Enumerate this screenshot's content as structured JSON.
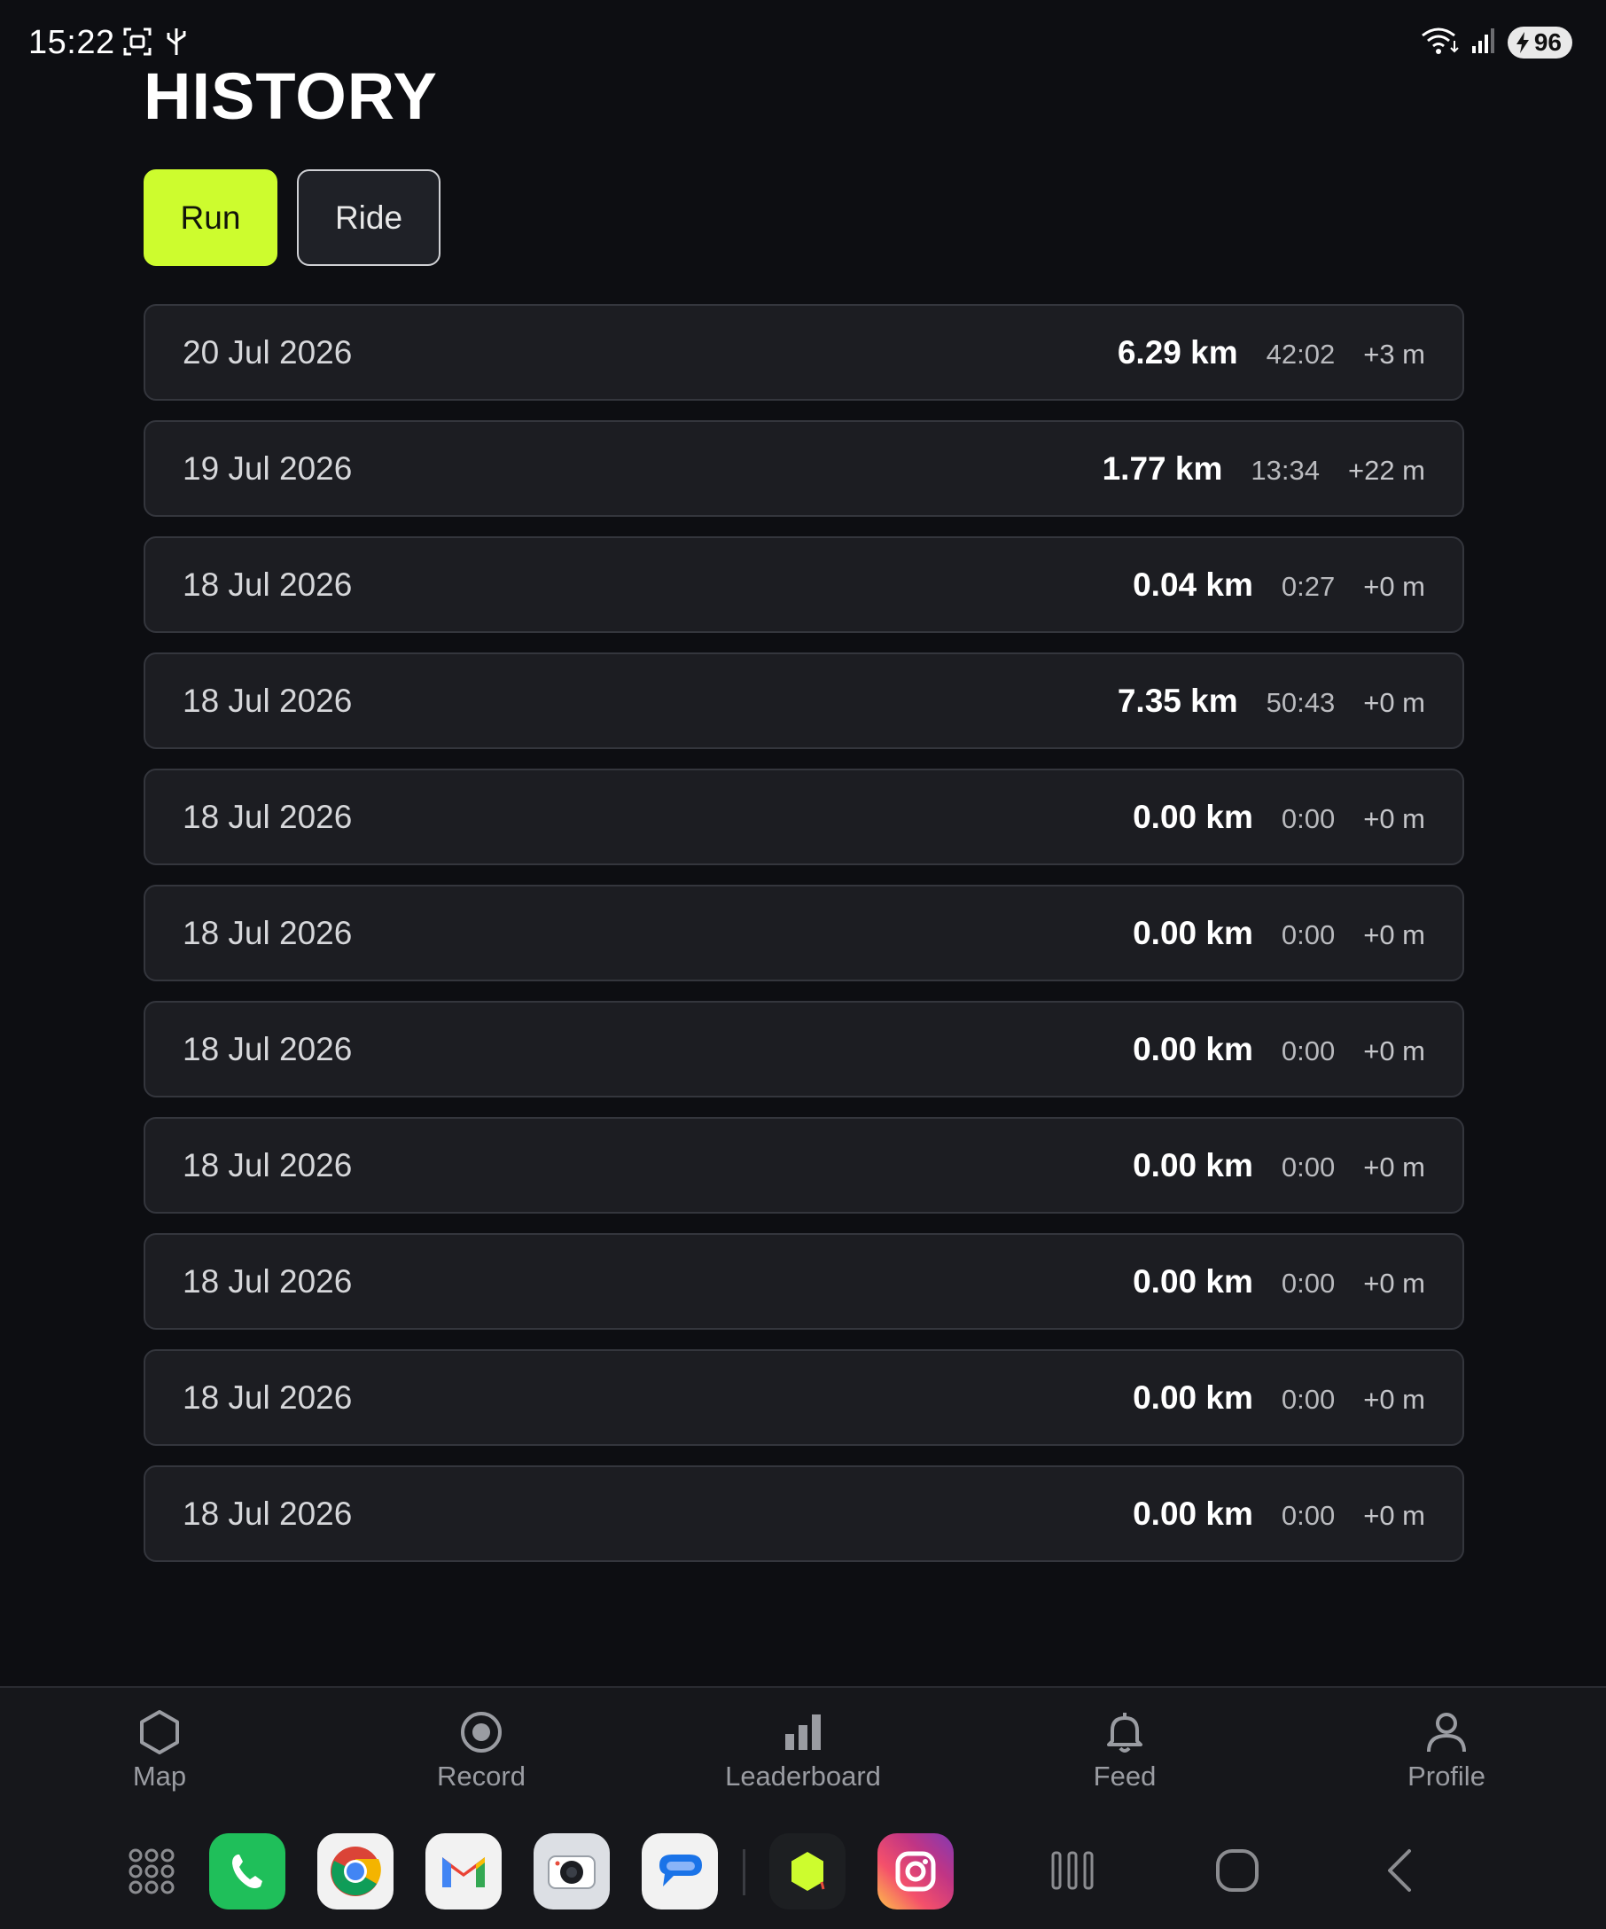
{
  "status_bar": {
    "time": "15:22",
    "battery": "96",
    "icons": [
      "screenshot-icon",
      "usb-icon",
      "wifi-icon",
      "signal-icon",
      "battery-icon"
    ]
  },
  "page": {
    "title": "HISTORY"
  },
  "tabs": [
    {
      "label": "Run",
      "active": true
    },
    {
      "label": "Ride",
      "active": false
    }
  ],
  "history": [
    {
      "date": "20 Jul 2026",
      "distance": "6.29 km",
      "duration": "42:02",
      "elevation": "+3 m"
    },
    {
      "date": "19 Jul 2026",
      "distance": "1.77 km",
      "duration": "13:34",
      "elevation": "+22 m"
    },
    {
      "date": "18 Jul 2026",
      "distance": "0.04 km",
      "duration": "0:27",
      "elevation": "+0 m"
    },
    {
      "date": "18 Jul 2026",
      "distance": "7.35 km",
      "duration": "50:43",
      "elevation": "+0 m"
    },
    {
      "date": "18 Jul 2026",
      "distance": "0.00 km",
      "duration": "0:00",
      "elevation": "+0 m"
    },
    {
      "date": "18 Jul 2026",
      "distance": "0.00 km",
      "duration": "0:00",
      "elevation": "+0 m"
    },
    {
      "date": "18 Jul 2026",
      "distance": "0.00 km",
      "duration": "0:00",
      "elevation": "+0 m"
    },
    {
      "date": "18 Jul 2026",
      "distance": "0.00 km",
      "duration": "0:00",
      "elevation": "+0 m"
    },
    {
      "date": "18 Jul 2026",
      "distance": "0.00 km",
      "duration": "0:00",
      "elevation": "+0 m"
    },
    {
      "date": "18 Jul 2026",
      "distance": "0.00 km",
      "duration": "0:00",
      "elevation": "+0 m"
    },
    {
      "date": "18 Jul 2026",
      "distance": "0.00 km",
      "duration": "0:00",
      "elevation": "+0 m"
    }
  ],
  "nav": [
    {
      "label": "Map",
      "icon": "hexagon-icon"
    },
    {
      "label": "Record",
      "icon": "record-icon"
    },
    {
      "label": "Leaderboard",
      "icon": "bar-chart-icon"
    },
    {
      "label": "Feed",
      "icon": "bell-icon"
    },
    {
      "label": "Profile",
      "icon": "person-icon"
    }
  ],
  "dock": {
    "apps": [
      "app-drawer-icon",
      "phone-app-icon",
      "chrome-app-icon",
      "gmail-app-icon",
      "camera-app-icon",
      "messages-app-icon",
      "hex-app-icon",
      "instagram-app-icon"
    ],
    "system": [
      "recents-icon",
      "home-icon",
      "back-icon"
    ]
  },
  "colors": {
    "background": "#0d0e12",
    "accent": "#cdfc2e",
    "card": "#1c1d22",
    "card_border": "#34363d"
  }
}
